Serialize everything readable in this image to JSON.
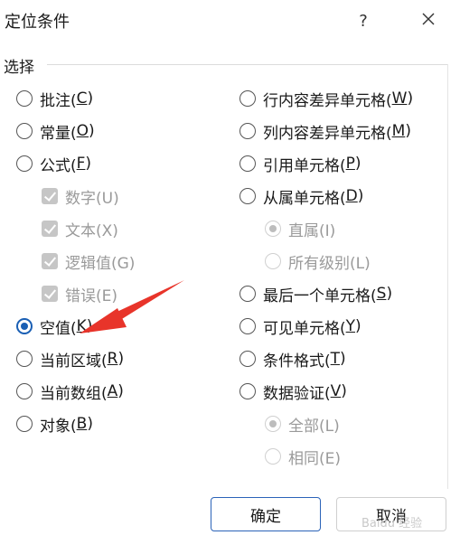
{
  "dialog": {
    "title": "定位条件",
    "help": "?",
    "group_label": "选择"
  },
  "left_options": [
    {
      "label": "批注(",
      "key": "C",
      "tail": ")",
      "type": "radio",
      "checked": false,
      "disabled": false
    },
    {
      "label": "常量(",
      "key": "O",
      "tail": ")",
      "type": "radio",
      "checked": false,
      "disabled": false
    },
    {
      "label": "公式(",
      "key": "F",
      "tail": ")",
      "type": "radio",
      "checked": false,
      "disabled": false
    },
    {
      "label": "数字(U)",
      "key": "",
      "tail": "",
      "type": "checkbox",
      "checked": true,
      "disabled": true
    },
    {
      "label": "文本(X)",
      "key": "",
      "tail": "",
      "type": "checkbox",
      "checked": true,
      "disabled": true
    },
    {
      "label": "逻辑值(G)",
      "key": "",
      "tail": "",
      "type": "checkbox",
      "checked": true,
      "disabled": true
    },
    {
      "label": "错误(E)",
      "key": "",
      "tail": "",
      "type": "checkbox",
      "checked": true,
      "disabled": true
    },
    {
      "label": "空值(",
      "key": "K",
      "tail": ")",
      "type": "radio",
      "checked": true,
      "disabled": false
    },
    {
      "label": "当前区域(",
      "key": "R",
      "tail": ")",
      "type": "radio",
      "checked": false,
      "disabled": false
    },
    {
      "label": "当前数组(",
      "key": "A",
      "tail": ")",
      "type": "radio",
      "checked": false,
      "disabled": false
    },
    {
      "label": "对象(",
      "key": "B",
      "tail": ")",
      "type": "radio",
      "checked": false,
      "disabled": false
    }
  ],
  "right_options": [
    {
      "label": "行内容差异单元格(",
      "key": "W",
      "tail": ")",
      "type": "radio",
      "checked": false,
      "disabled": false
    },
    {
      "label": "列内容差异单元格(",
      "key": "M",
      "tail": ")",
      "type": "radio",
      "checked": false,
      "disabled": false
    },
    {
      "label": "引用单元格(",
      "key": "P",
      "tail": ")",
      "type": "radio",
      "checked": false,
      "disabled": false
    },
    {
      "label": "从属单元格(",
      "key": "D",
      "tail": ")",
      "type": "radio",
      "checked": false,
      "disabled": false
    },
    {
      "label": "直属(I)",
      "key": "",
      "tail": "",
      "type": "radio",
      "checked": true,
      "disabled": true
    },
    {
      "label": "所有级别(L)",
      "key": "",
      "tail": "",
      "type": "radio",
      "checked": false,
      "disabled": true
    },
    {
      "label": "最后一个单元格(",
      "key": "S",
      "tail": ")",
      "type": "radio",
      "checked": false,
      "disabled": false
    },
    {
      "label": "可见单元格(",
      "key": "Y",
      "tail": ")",
      "type": "radio",
      "checked": false,
      "disabled": false
    },
    {
      "label": "条件格式(",
      "key": "T",
      "tail": ")",
      "type": "radio",
      "checked": false,
      "disabled": false
    },
    {
      "label": "数据验证(",
      "key": "V",
      "tail": ")",
      "type": "radio",
      "checked": false,
      "disabled": false
    },
    {
      "label": "全部(L)",
      "key": "",
      "tail": "",
      "type": "radio",
      "checked": true,
      "disabled": true
    },
    {
      "label": "相同(E)",
      "key": "",
      "tail": "",
      "type": "radio",
      "checked": false,
      "disabled": true
    }
  ],
  "buttons": {
    "ok": "确定",
    "cancel": "取消"
  },
  "watermark": "Baidu 经验",
  "icons": {
    "close": "close-icon",
    "annotation": "red-arrow-icon"
  },
  "colors": {
    "accent": "#1a5fb4",
    "annotation_arrow": "#e8342a"
  }
}
